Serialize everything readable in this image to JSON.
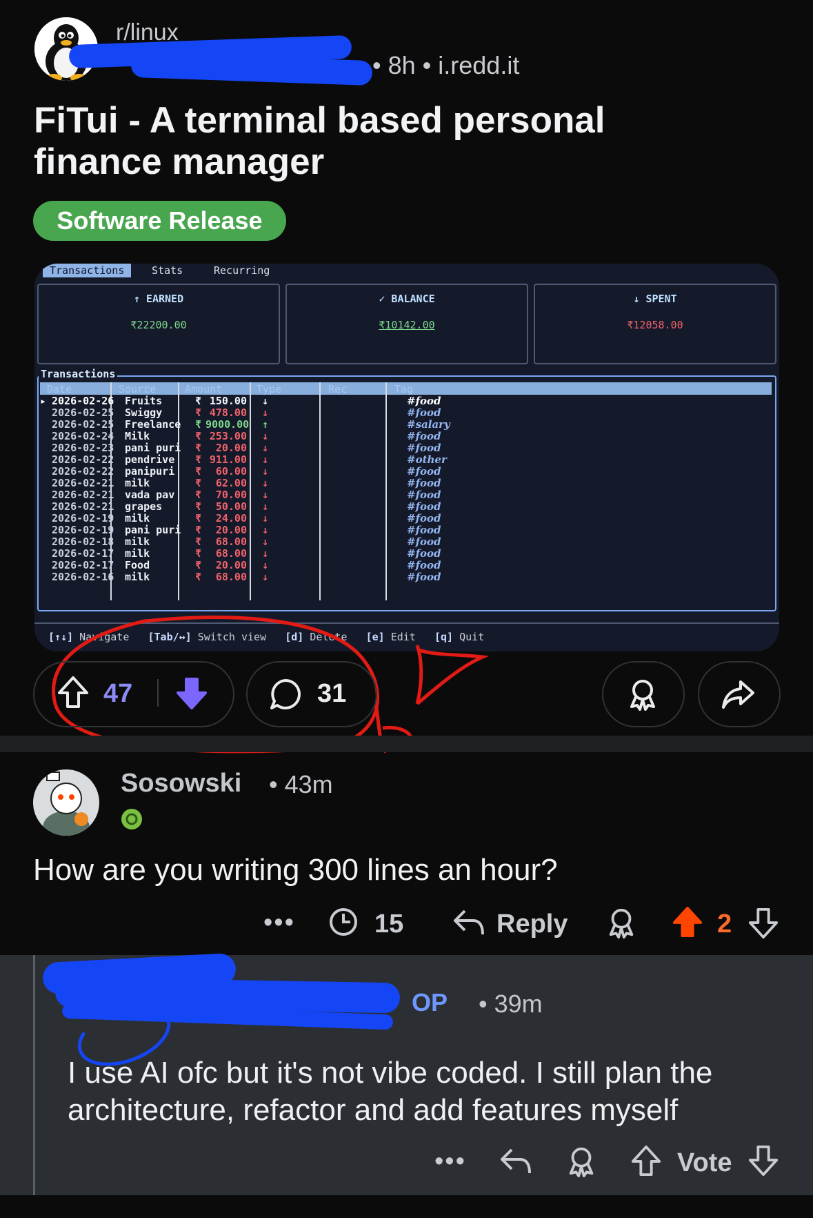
{
  "post": {
    "subreddit": "r/linux",
    "age": "8h",
    "domain": "i.redd.it",
    "title": "FiTui - A terminal based personal finance manager",
    "flair": "Software Release",
    "votes": "47",
    "comments": "31"
  },
  "terminal": {
    "tabs": [
      "Transactions",
      "Stats",
      "Recurring"
    ],
    "cards": [
      {
        "label": "↑ EARNED",
        "value": "₹22200.00",
        "color": "#7dd98a"
      },
      {
        "label": "✓ BALANCE",
        "value": "₹10142.00",
        "color": "#7dd98a"
      },
      {
        "label": "↓ SPENT",
        "value": "₹12058.00",
        "color": "#f2626a"
      }
    ],
    "section_title": "Transactions",
    "columns": [
      "Date",
      "Source",
      "Amount",
      "Type",
      "Rec",
      "Tag"
    ],
    "rows": [
      {
        "date": "2026-02-26",
        "source": "Fruits",
        "amount": "150.00",
        "type": "↓",
        "tag": "#food",
        "kind": "selected"
      },
      {
        "date": "2026-02-25",
        "source": "Swiggy",
        "amount": "478.00",
        "type": "↓",
        "tag": "#food",
        "kind": "debit"
      },
      {
        "date": "2026-02-25",
        "source": "Freelance",
        "amount": "9000.00",
        "type": "↑",
        "tag": "#salary",
        "kind": "credit"
      },
      {
        "date": "2026-02-24",
        "source": "Milk",
        "amount": "253.00",
        "type": "↓",
        "tag": "#food",
        "kind": "debit"
      },
      {
        "date": "2026-02-23",
        "source": "pani puri",
        "amount": "20.00",
        "type": "↓",
        "tag": "#food",
        "kind": "debit"
      },
      {
        "date": "2026-02-22",
        "source": "pendrive",
        "amount": "911.00",
        "type": "↓",
        "tag": "#other",
        "kind": "debit"
      },
      {
        "date": "2026-02-22",
        "source": "panipuri",
        "amount": "60.00",
        "type": "↓",
        "tag": "#food",
        "kind": "debit"
      },
      {
        "date": "2026-02-21",
        "source": "milk",
        "amount": "62.00",
        "type": "↓",
        "tag": "#food",
        "kind": "debit"
      },
      {
        "date": "2026-02-21",
        "source": "vada pav",
        "amount": "70.00",
        "type": "↓",
        "tag": "#food",
        "kind": "debit"
      },
      {
        "date": "2026-02-21",
        "source": "grapes",
        "amount": "50.00",
        "type": "↓",
        "tag": "#food",
        "kind": "debit"
      },
      {
        "date": "2026-02-19",
        "source": "milk",
        "amount": "24.00",
        "type": "↓",
        "tag": "#food",
        "kind": "debit"
      },
      {
        "date": "2026-02-19",
        "source": "pani puri",
        "amount": "20.00",
        "type": "↓",
        "tag": "#food",
        "kind": "debit"
      },
      {
        "date": "2026-02-18",
        "source": "milk",
        "amount": "68.00",
        "type": "↓",
        "tag": "#food",
        "kind": "debit"
      },
      {
        "date": "2026-02-17",
        "source": "milk",
        "amount": "68.00",
        "type": "↓",
        "tag": "#food",
        "kind": "debit"
      },
      {
        "date": "2026-02-17",
        "source": "Food",
        "amount": "20.00",
        "type": "↓",
        "tag": "#food",
        "kind": "debit"
      },
      {
        "date": "2026-02-16",
        "source": "milk",
        "amount": "68.00",
        "type": "↓",
        "tag": "#food",
        "kind": "debit"
      }
    ],
    "currency_symbol": "₹",
    "footer": [
      {
        "key": "[↑↓]",
        "label": "Navigate"
      },
      {
        "key": "[Tab/↔]",
        "label": "Switch view"
      },
      {
        "key": "[d]",
        "label": "Delete"
      },
      {
        "key": "[e]",
        "label": "Edit"
      },
      {
        "key": "[q]",
        "label": "Quit"
      }
    ]
  },
  "comment1": {
    "user": "Sosowski",
    "age": "43m",
    "body": "How are you writing 300 lines an hour?",
    "more": "•••",
    "awards": "15",
    "reply_label": "Reply",
    "score": "2"
  },
  "reply": {
    "op_badge": "OP",
    "age": "39m",
    "body": "I use AI ofc but it's not vibe coded. I still plan the architecture, refactor and add features myself",
    "more": "•••",
    "vote_label": "Vote"
  },
  "colors": {
    "upvote_active": "#ff4500",
    "downvote_active": "#7b66ff",
    "flair_green": "#48a64e",
    "op_blue": "#6f98ff",
    "annotation_red": "#e21b14",
    "redaction_blue": "#1546f5"
  },
  "icons": [
    "upvote-icon",
    "downvote-icon",
    "comment-icon",
    "award-icon",
    "share-icon",
    "timer-icon",
    "reply-icon"
  ]
}
